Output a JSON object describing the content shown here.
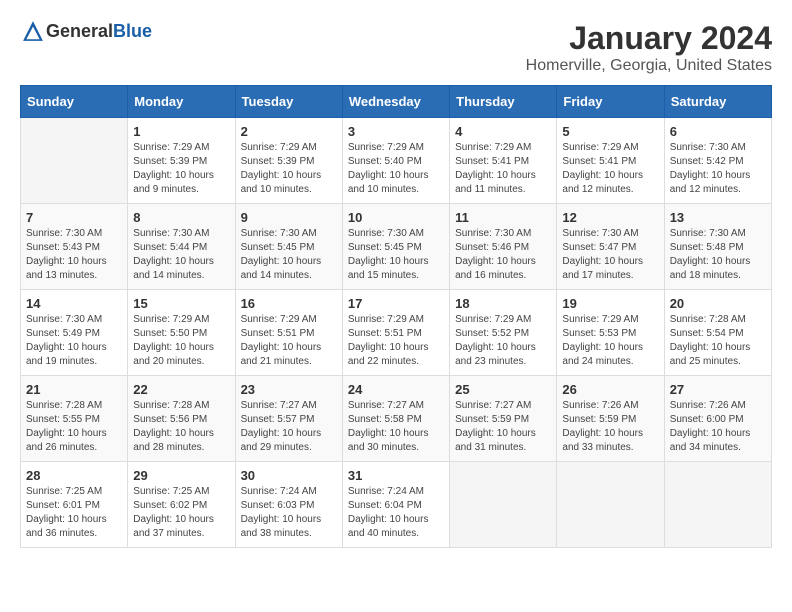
{
  "header": {
    "logo_general": "General",
    "logo_blue": "Blue",
    "title": "January 2024",
    "subtitle": "Homerville, Georgia, United States"
  },
  "columns": [
    "Sunday",
    "Monday",
    "Tuesday",
    "Wednesday",
    "Thursday",
    "Friday",
    "Saturday"
  ],
  "weeks": [
    [
      {
        "day": "",
        "sunrise": "",
        "sunset": "",
        "daylight": "",
        "empty": true
      },
      {
        "day": "1",
        "sunrise": "Sunrise: 7:29 AM",
        "sunset": "Sunset: 5:39 PM",
        "daylight": "Daylight: 10 hours and 9 minutes."
      },
      {
        "day": "2",
        "sunrise": "Sunrise: 7:29 AM",
        "sunset": "Sunset: 5:39 PM",
        "daylight": "Daylight: 10 hours and 10 minutes."
      },
      {
        "day": "3",
        "sunrise": "Sunrise: 7:29 AM",
        "sunset": "Sunset: 5:40 PM",
        "daylight": "Daylight: 10 hours and 10 minutes."
      },
      {
        "day": "4",
        "sunrise": "Sunrise: 7:29 AM",
        "sunset": "Sunset: 5:41 PM",
        "daylight": "Daylight: 10 hours and 11 minutes."
      },
      {
        "day": "5",
        "sunrise": "Sunrise: 7:29 AM",
        "sunset": "Sunset: 5:41 PM",
        "daylight": "Daylight: 10 hours and 12 minutes."
      },
      {
        "day": "6",
        "sunrise": "Sunrise: 7:30 AM",
        "sunset": "Sunset: 5:42 PM",
        "daylight": "Daylight: 10 hours and 12 minutes."
      }
    ],
    [
      {
        "day": "7",
        "sunrise": "Sunrise: 7:30 AM",
        "sunset": "Sunset: 5:43 PM",
        "daylight": "Daylight: 10 hours and 13 minutes."
      },
      {
        "day": "8",
        "sunrise": "Sunrise: 7:30 AM",
        "sunset": "Sunset: 5:44 PM",
        "daylight": "Daylight: 10 hours and 14 minutes."
      },
      {
        "day": "9",
        "sunrise": "Sunrise: 7:30 AM",
        "sunset": "Sunset: 5:45 PM",
        "daylight": "Daylight: 10 hours and 14 minutes."
      },
      {
        "day": "10",
        "sunrise": "Sunrise: 7:30 AM",
        "sunset": "Sunset: 5:45 PM",
        "daylight": "Daylight: 10 hours and 15 minutes."
      },
      {
        "day": "11",
        "sunrise": "Sunrise: 7:30 AM",
        "sunset": "Sunset: 5:46 PM",
        "daylight": "Daylight: 10 hours and 16 minutes."
      },
      {
        "day": "12",
        "sunrise": "Sunrise: 7:30 AM",
        "sunset": "Sunset: 5:47 PM",
        "daylight": "Daylight: 10 hours and 17 minutes."
      },
      {
        "day": "13",
        "sunrise": "Sunrise: 7:30 AM",
        "sunset": "Sunset: 5:48 PM",
        "daylight": "Daylight: 10 hours and 18 minutes."
      }
    ],
    [
      {
        "day": "14",
        "sunrise": "Sunrise: 7:30 AM",
        "sunset": "Sunset: 5:49 PM",
        "daylight": "Daylight: 10 hours and 19 minutes."
      },
      {
        "day": "15",
        "sunrise": "Sunrise: 7:29 AM",
        "sunset": "Sunset: 5:50 PM",
        "daylight": "Daylight: 10 hours and 20 minutes."
      },
      {
        "day": "16",
        "sunrise": "Sunrise: 7:29 AM",
        "sunset": "Sunset: 5:51 PM",
        "daylight": "Daylight: 10 hours and 21 minutes."
      },
      {
        "day": "17",
        "sunrise": "Sunrise: 7:29 AM",
        "sunset": "Sunset: 5:51 PM",
        "daylight": "Daylight: 10 hours and 22 minutes."
      },
      {
        "day": "18",
        "sunrise": "Sunrise: 7:29 AM",
        "sunset": "Sunset: 5:52 PM",
        "daylight": "Daylight: 10 hours and 23 minutes."
      },
      {
        "day": "19",
        "sunrise": "Sunrise: 7:29 AM",
        "sunset": "Sunset: 5:53 PM",
        "daylight": "Daylight: 10 hours and 24 minutes."
      },
      {
        "day": "20",
        "sunrise": "Sunrise: 7:28 AM",
        "sunset": "Sunset: 5:54 PM",
        "daylight": "Daylight: 10 hours and 25 minutes."
      }
    ],
    [
      {
        "day": "21",
        "sunrise": "Sunrise: 7:28 AM",
        "sunset": "Sunset: 5:55 PM",
        "daylight": "Daylight: 10 hours and 26 minutes."
      },
      {
        "day": "22",
        "sunrise": "Sunrise: 7:28 AM",
        "sunset": "Sunset: 5:56 PM",
        "daylight": "Daylight: 10 hours and 28 minutes."
      },
      {
        "day": "23",
        "sunrise": "Sunrise: 7:27 AM",
        "sunset": "Sunset: 5:57 PM",
        "daylight": "Daylight: 10 hours and 29 minutes."
      },
      {
        "day": "24",
        "sunrise": "Sunrise: 7:27 AM",
        "sunset": "Sunset: 5:58 PM",
        "daylight": "Daylight: 10 hours and 30 minutes."
      },
      {
        "day": "25",
        "sunrise": "Sunrise: 7:27 AM",
        "sunset": "Sunset: 5:59 PM",
        "daylight": "Daylight: 10 hours and 31 minutes."
      },
      {
        "day": "26",
        "sunrise": "Sunrise: 7:26 AM",
        "sunset": "Sunset: 5:59 PM",
        "daylight": "Daylight: 10 hours and 33 minutes."
      },
      {
        "day": "27",
        "sunrise": "Sunrise: 7:26 AM",
        "sunset": "Sunset: 6:00 PM",
        "daylight": "Daylight: 10 hours and 34 minutes."
      }
    ],
    [
      {
        "day": "28",
        "sunrise": "Sunrise: 7:25 AM",
        "sunset": "Sunset: 6:01 PM",
        "daylight": "Daylight: 10 hours and 36 minutes."
      },
      {
        "day": "29",
        "sunrise": "Sunrise: 7:25 AM",
        "sunset": "Sunset: 6:02 PM",
        "daylight": "Daylight: 10 hours and 37 minutes."
      },
      {
        "day": "30",
        "sunrise": "Sunrise: 7:24 AM",
        "sunset": "Sunset: 6:03 PM",
        "daylight": "Daylight: 10 hours and 38 minutes."
      },
      {
        "day": "31",
        "sunrise": "Sunrise: 7:24 AM",
        "sunset": "Sunset: 6:04 PM",
        "daylight": "Daylight: 10 hours and 40 minutes."
      },
      {
        "day": "",
        "sunrise": "",
        "sunset": "",
        "daylight": "",
        "empty": true
      },
      {
        "day": "",
        "sunrise": "",
        "sunset": "",
        "daylight": "",
        "empty": true
      },
      {
        "day": "",
        "sunrise": "",
        "sunset": "",
        "daylight": "",
        "empty": true
      }
    ]
  ]
}
